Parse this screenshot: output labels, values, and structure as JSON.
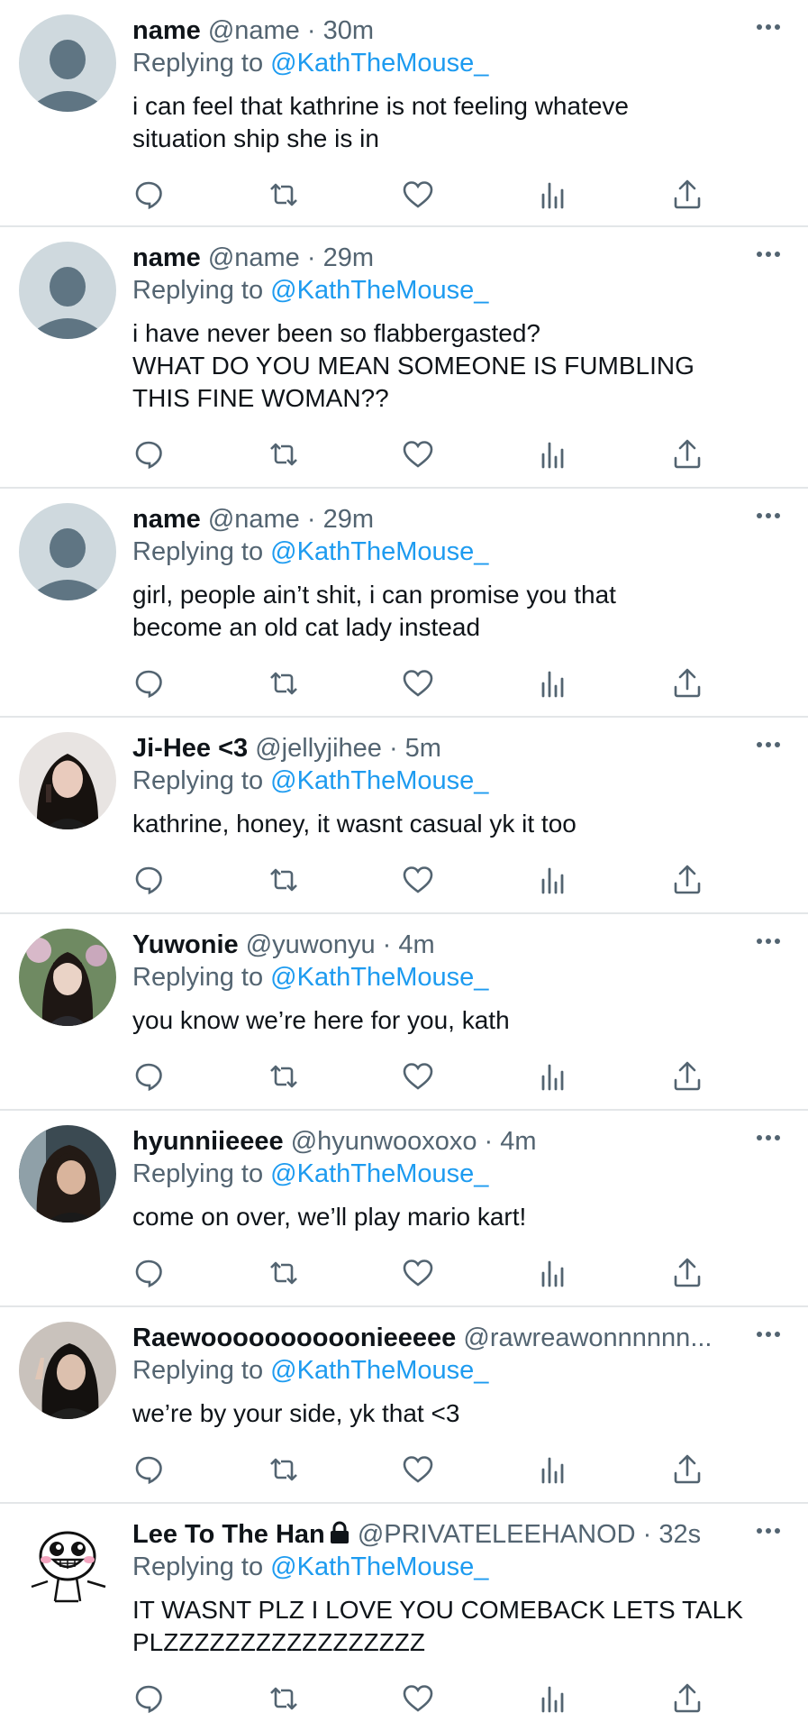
{
  "replying_prefix": "Replying to",
  "replying_to": "@KathTheMouse_",
  "tweets": [
    {
      "name": "name",
      "handle": "@name",
      "time": "· 30m",
      "line1": "i can feel that kathrine is not feeling whateve",
      "line2": "situation ship she is in",
      "line3": "",
      "avatar": "default-avatar"
    },
    {
      "name": "name",
      "handle": "@name",
      "time": "· 29m",
      "line1": "i have never been so flabbergasted?",
      "line2": "WHAT DO YOU MEAN SOMEONE IS FUMBLING",
      "line3": "THIS FINE WOMAN??",
      "avatar": "default-avatar"
    },
    {
      "name": "name",
      "handle": "@name",
      "time": "· 29m",
      "line1": "girl, people ain’t shit, i can promise you that",
      "line2": "become an old cat lady instead",
      "line3": "",
      "avatar": "default-avatar"
    },
    {
      "name": "Ji-Hee <3",
      "handle": "@jellyjihee",
      "time": "· 5m",
      "line1": "kathrine, honey, it wasnt casual yk it too",
      "line2": "",
      "line3": "",
      "avatar": "photo-avatar"
    },
    {
      "name": "Yuwonie",
      "handle": "@yuwonyu",
      "time": "· 4m",
      "line1": "you know we’re here for you, kath",
      "line2": "",
      "line3": "",
      "avatar": "photo-avatar"
    },
    {
      "name": "hyunniieeee",
      "handle": "@hyunwooxoxo",
      "time": "· 4m",
      "line1": "come on over, we’ll play mario kart!",
      "line2": "",
      "line3": "",
      "avatar": "photo-avatar"
    },
    {
      "name": "Raewoooooooooonieeeee",
      "handle": "@rawreawonnnnnn...",
      "time": "",
      "line1": "we’re by your side, yk that <3",
      "line2": "",
      "line3": "",
      "avatar": "photo-avatar"
    },
    {
      "name": "Lee To The Han",
      "handle": "@PRIVATELEEHANOD",
      "time": "· 32s",
      "line1": "IT WASNT PLZ I LOVE YOU COMEBACK LETS TALK",
      "line2": "PLZZZZZZZZZZZZZZZZZ",
      "line3": "",
      "avatar": "cartoon-avatar",
      "locked": true
    }
  ],
  "icons": {
    "reply": "reply-icon",
    "retweet": "retweet-icon",
    "like": "heart-icon",
    "views": "views-icon",
    "share": "share-icon",
    "more": "more-icon",
    "lock": "lock-icon"
  },
  "colors": {
    "mention": "#1d9bf0",
    "secondary_text": "#536471",
    "primary_text": "#0f1419",
    "divider": "#e3e6e8",
    "icon": "#536471"
  }
}
